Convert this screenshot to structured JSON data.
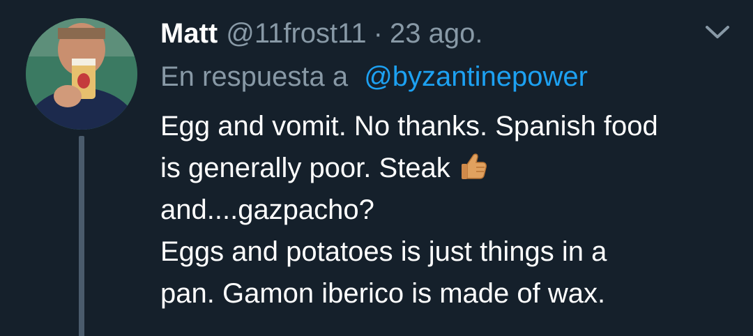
{
  "tweet": {
    "author_name": "Matt",
    "author_handle": "@11frost11",
    "separator": "·",
    "date": "23 ago.",
    "reply_prefix": "En respuesta a",
    "reply_mention": "@byzantinepower",
    "text_lines": [
      "Egg and vomit. No thanks. Spanish food",
      "is generally poor. Steak",
      "and....gazpacho?",
      "Eggs and potatoes is just things in a",
      "pan. Gamon iberico is made of wax."
    ],
    "inline_emoji": "thumbs-up-icon"
  },
  "icons": {
    "menu": "chevron-down-icon",
    "avatar": "avatar"
  },
  "colors": {
    "background": "#15202b",
    "text_primary": "#ffffff",
    "text_secondary": "#8899a6",
    "link": "#1da1f2",
    "thread_line": "#4a5b6c"
  }
}
